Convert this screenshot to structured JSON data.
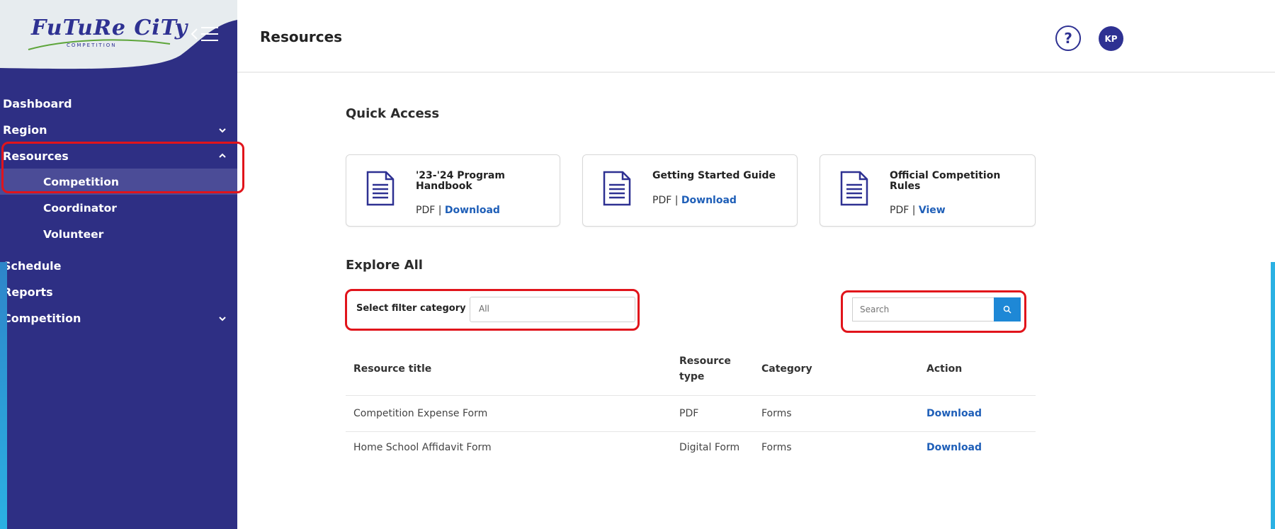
{
  "brand": {
    "logo_text": "FuTuRe CiTy",
    "logo_sub": "COMPETITION"
  },
  "sidebar": {
    "items": [
      {
        "label": "Dashboard"
      },
      {
        "label": "Region"
      },
      {
        "label": "Resources"
      },
      {
        "label": "Competition"
      },
      {
        "label": "Coordinator"
      },
      {
        "label": "Volunteer"
      },
      {
        "label": "Schedule"
      },
      {
        "label": "Reports"
      },
      {
        "label": "Competition"
      }
    ]
  },
  "header": {
    "title": "Resources",
    "help_glyph": "?",
    "avatar_initials": "KP"
  },
  "quick_access": {
    "title": "Quick Access",
    "cards": [
      {
        "title": "'23-'24 Program Handbook",
        "type": "PDF",
        "separator": "|",
        "action": "Download"
      },
      {
        "title": "Getting Started Guide",
        "type": "PDF",
        "separator": "|",
        "action": "Download"
      },
      {
        "title": "Official Competition Rules",
        "type": "PDF",
        "separator": "|",
        "action": "View"
      }
    ]
  },
  "explore": {
    "title": "Explore All",
    "filter_label": "Select filter category",
    "filter_value": "All",
    "search_placeholder": "Search"
  },
  "table": {
    "headers": {
      "title": "Resource title",
      "type_line1": "Resource",
      "type_line2": "type",
      "category": "Category",
      "action": "Action"
    },
    "rows": [
      {
        "title": "Competition Expense Form",
        "type": "PDF",
        "category": "Forms",
        "action": "Download"
      },
      {
        "title": "Home School Affidavit Form",
        "type": "Digital Form",
        "category": "Forms",
        "action": "Download"
      }
    ]
  },
  "colors": {
    "sidebar_bg": "#2e2f84",
    "accent_blue": "#1e88d6",
    "link_blue": "#1f5fb8",
    "highlight_red": "#e1141b"
  }
}
